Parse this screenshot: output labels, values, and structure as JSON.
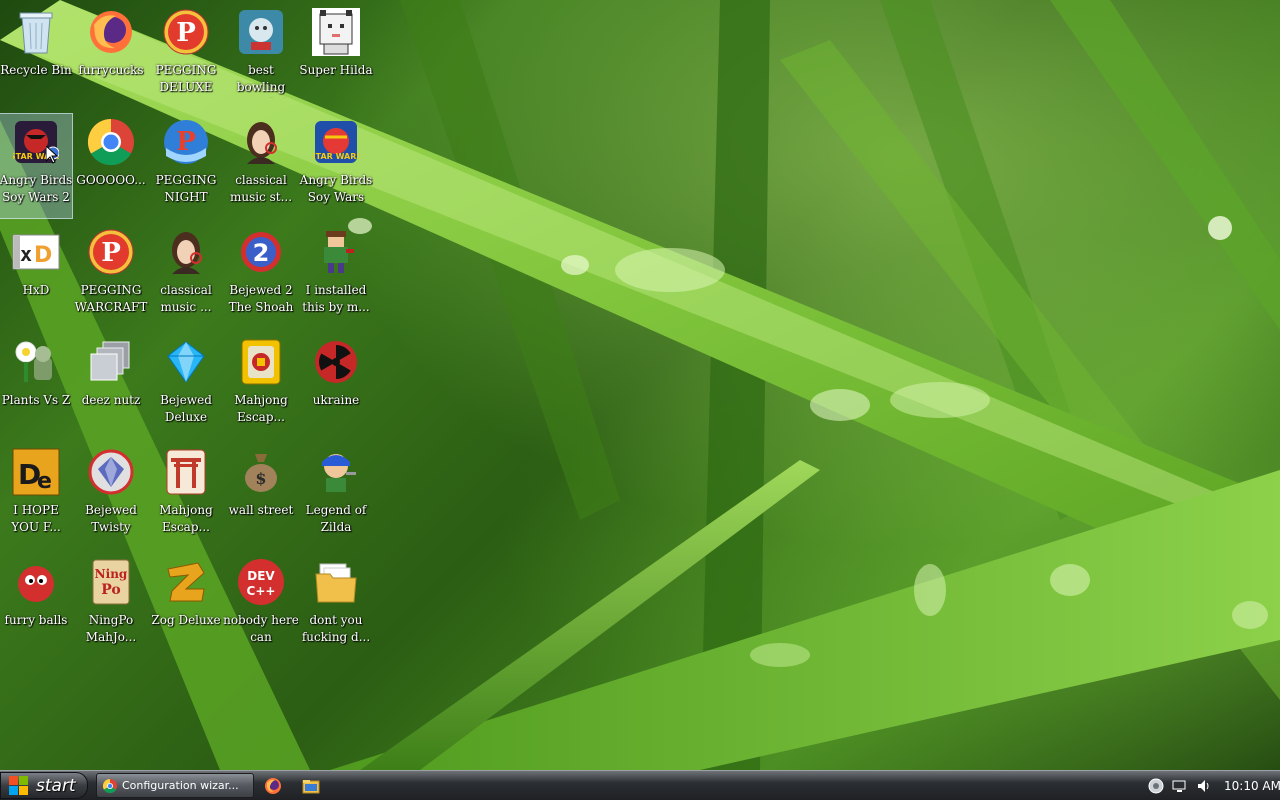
{
  "desktop": {
    "icons": [
      {
        "label": "Recycle Bin",
        "icon": "recycle-bin-icon"
      },
      {
        "label": "furrycucks",
        "icon": "firefox-icon"
      },
      {
        "label": "PEGGING\nDELUXE",
        "icon": "pegging-p-icon"
      },
      {
        "label": "best bowling\ngame of al...",
        "icon": "bowling-game-icon"
      },
      {
        "label": "Super Hilda",
        "icon": "pixel-cat-icon"
      },
      {
        "label": "Angry Birds\nSoy Wars 2",
        "icon": "angry-birds-star-wars-2-icon"
      },
      {
        "label": "GOOOOO...",
        "icon": "chrome-icon"
      },
      {
        "label": "PEGGING\nNIGHT",
        "icon": "pegging-p-blue-icon"
      },
      {
        "label": "classical\nmusic st...",
        "icon": "classical-portrait-icon"
      },
      {
        "label": "Angry Birds\nSoy Wars",
        "icon": "angry-birds-star-wars-icon"
      },
      {
        "label": "HxD",
        "icon": "hxd-icon"
      },
      {
        "label": "PEGGING\nWARCRAFT",
        "icon": "pegging-p-icon"
      },
      {
        "label": "classical\nmusic ...",
        "icon": "classical-portrait-icon"
      },
      {
        "label": "Bejewed 2\nThe Shoah",
        "icon": "bejeweled-2-icon"
      },
      {
        "label": "I installed\nthis by m...",
        "icon": "pixel-character-icon"
      },
      {
        "label": "Plants Vs Z",
        "icon": "plants-vs-zombies-icon"
      },
      {
        "label": "deez nutz",
        "icon": "stacked-windows-icon"
      },
      {
        "label": "Bejewed\nDeluxe",
        "icon": "blue-gem-icon"
      },
      {
        "label": "Mahjong\nEscap...",
        "icon": "mahjong-tile-icon"
      },
      {
        "label": "ukraine",
        "icon": "radiation-icon"
      },
      {
        "label": "I HOPE\nYOU F...",
        "icon": "de-icon"
      },
      {
        "label": "Bejewed\nTwisty",
        "icon": "twist-gem-icon"
      },
      {
        "label": "Mahjong\nEscap...",
        "icon": "torii-gate-icon"
      },
      {
        "label": "wall street",
        "icon": "money-bag-icon"
      },
      {
        "label": "Legend of\nZilda",
        "icon": "zelda-character-icon"
      },
      {
        "label": "furry balls",
        "icon": "red-furball-icon"
      },
      {
        "label": "NingPo\nMahJo...",
        "icon": "ningpo-icon"
      },
      {
        "label": "Zog Deluxe",
        "icon": "zog-icon"
      },
      {
        "label": "nobody here\ncan program",
        "icon": "dev-cpp-icon"
      },
      {
        "label": "dont you\nfucking d...",
        "icon": "folder-icon"
      }
    ],
    "selected_label": "Angry Birds\nSoy Wars 2"
  },
  "taskbar": {
    "start_label": "start",
    "active_task": "Configuration wizar...",
    "quick_launch": [
      "firefox-icon",
      "file-explorer-icon"
    ],
    "tray_icons": [
      "network-globe-icon",
      "display-icon",
      "volume-icon"
    ],
    "clock": "10:10 AM"
  },
  "colors": {
    "wallpaper_green": "#3c7a1c",
    "taskbar_dark": "#1f2124",
    "label_text": "#ffffff"
  }
}
